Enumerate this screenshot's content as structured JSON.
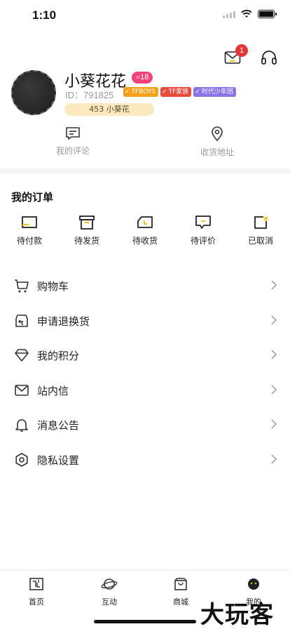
{
  "status_bar": {
    "time": "1:10"
  },
  "header": {
    "mail_badge_count": "1"
  },
  "profile": {
    "username": "小葵花花",
    "level": "18",
    "user_id": "ID：791825",
    "tags": [
      "TFBOYS",
      "TF家族",
      "时代少年团"
    ],
    "fans_label": "453 小葵花"
  },
  "quick_links": [
    {
      "label": "我的评论",
      "icon": "comment-icon"
    },
    {
      "label": "收货地址",
      "icon": "location-icon"
    }
  ],
  "orders": {
    "title": "我的订单",
    "items": [
      {
        "label": "待付款",
        "icon": "wallet-icon"
      },
      {
        "label": "待发货",
        "icon": "box-icon"
      },
      {
        "label": "待收货",
        "icon": "truck-icon"
      },
      {
        "label": "待评价",
        "icon": "review-icon"
      },
      {
        "label": "已取消",
        "icon": "cancel-icon"
      }
    ]
  },
  "menu": [
    {
      "label": "购物车",
      "icon": "cart-icon"
    },
    {
      "label": "申请退换货",
      "icon": "return-icon"
    },
    {
      "label": "我的积分",
      "icon": "diamond-icon"
    },
    {
      "label": "站内信",
      "icon": "mail-icon"
    },
    {
      "label": "消息公告",
      "icon": "bell-icon"
    },
    {
      "label": "隐私设置",
      "icon": "gear-icon"
    }
  ],
  "tabbar": [
    {
      "label": "首页",
      "icon": "home-icon"
    },
    {
      "label": "互动",
      "icon": "planet-icon"
    },
    {
      "label": "商城",
      "icon": "bag-icon"
    },
    {
      "label": "我的",
      "icon": "face-icon"
    }
  ],
  "watermark": "大玩客",
  "colors": {
    "accent": "#f4c21b",
    "badge": "#e8343b",
    "level_pink": "#f0437a"
  }
}
